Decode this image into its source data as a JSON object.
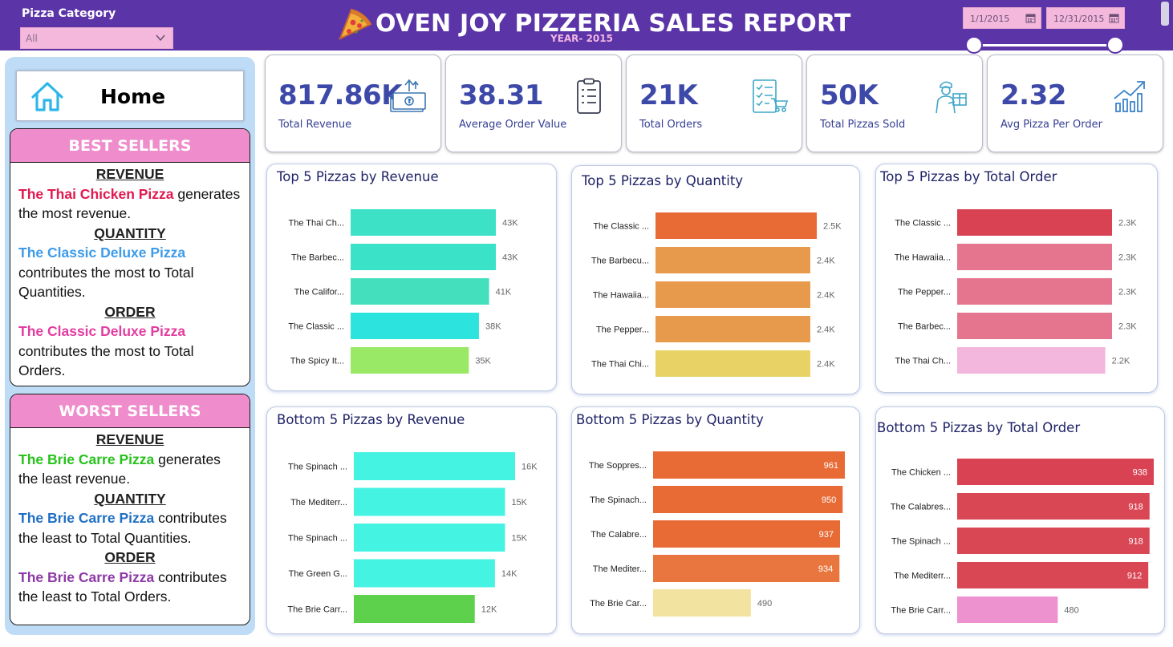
{
  "header": {
    "category_label": "Pizza Category",
    "category_value": "All",
    "title": "OVEN JOY PIZZERIA SALES REPORT",
    "subtitle": "YEAR- 2015",
    "date_start": "1/1/2015",
    "date_end": "12/31/2015"
  },
  "nav": {
    "home_label": "Home"
  },
  "best_sellers": {
    "title": "BEST SELLERS",
    "revenue_heading": "REVENUE",
    "revenue_pizza": "The Thai Chicken Pizza",
    "revenue_text": " generates the most revenue.",
    "quantity_heading": "QUANTITY",
    "quantity_pizza": "The Classic Deluxe Pizza",
    "quantity_text": " contributes the most to Total Quantities.",
    "order_heading": "ORDER",
    "order_pizza": "The Classic Deluxe Pizza",
    "order_text": " contributes the most to Total Orders."
  },
  "worst_sellers": {
    "title": "WORST SELLERS",
    "revenue_heading": "REVENUE",
    "revenue_pizza": "The Brie Carre Pizza",
    "revenue_text": " generates the least revenue.",
    "quantity_heading": "QUANTITY",
    "quantity_pizza": "The Brie Carre Pizza",
    "quantity_text": " contributes the least to Total Quantities.",
    "order_heading": "ORDER",
    "order_pizza": "The Brie Carre Pizza",
    "order_text": " contributes the least to Total Orders."
  },
  "colors": {
    "header_bg": "#5b35a8",
    "kpi_value": "#3c49a8",
    "best_rev": "#e0194f",
    "best_qty": "#3d9be9",
    "best_ord": "#e23d9f",
    "worst_rev": "#27c21c",
    "worst_qty": "#1f6fc4",
    "worst_ord": "#8e3aa6"
  },
  "kpis": [
    {
      "value": "817.86K",
      "label": "Total Revenue",
      "icon": "money-icon"
    },
    {
      "value": "38.31",
      "label": "Average Order Value",
      "icon": "clipboard-icon"
    },
    {
      "value": "21K",
      "label": "Total Orders",
      "icon": "order-list-icon"
    },
    {
      "value": "50K",
      "label": "Total Pizzas Sold",
      "icon": "delivery-icon"
    },
    {
      "value": "2.32",
      "label": "Avg Pizza Per Order",
      "icon": "growth-chart-icon"
    }
  ],
  "chart_data": [
    {
      "type": "bar",
      "orientation": "horizontal",
      "title": "Top 5 Pizzas by Revenue",
      "categories": [
        "The Thai Ch...",
        "The Barbec...",
        "The Califor...",
        "The Classic ...",
        "The Spicy It..."
      ],
      "values": [
        43000,
        43000,
        41000,
        38000,
        35000
      ],
      "labels": [
        "43K",
        "43K",
        "41K",
        "38K",
        "35K"
      ],
      "colors": [
        "#3ce1c6",
        "#3ae2c8",
        "#44e0be",
        "#2de3dd",
        "#99e966"
      ],
      "label_position": "outside"
    },
    {
      "type": "bar",
      "orientation": "horizontal",
      "title": "Top 5 Pizzas by Quantity",
      "categories": [
        "The Classic ...",
        "The Barbecu...",
        "The Hawaiia...",
        "The Pepper...",
        "The Thai Chi..."
      ],
      "values": [
        2500,
        2400,
        2400,
        2400,
        2400
      ],
      "labels": [
        "2.5K",
        "2.4K",
        "2.4K",
        "2.4K",
        "2.4K"
      ],
      "colors": [
        "#e86b36",
        "#e89a4c",
        "#e89a4c",
        "#e89a4c",
        "#e8d266"
      ],
      "label_position": "outside"
    },
    {
      "type": "bar",
      "orientation": "horizontal",
      "title": "Top 5 Pizzas by Total Order",
      "categories": [
        "The Classic ...",
        "The Hawaiia...",
        "The Pepper...",
        "The Barbec...",
        "The Thai Ch..."
      ],
      "values": [
        2300,
        2300,
        2300,
        2300,
        2200
      ],
      "labels": [
        "2.3K",
        "2.3K",
        "2.3K",
        "2.3K",
        "2.2K"
      ],
      "colors": [
        "#d94253",
        "#e5758e",
        "#e5758e",
        "#e5758e",
        "#f3b6dc"
      ],
      "label_position": "outside"
    },
    {
      "type": "bar",
      "orientation": "horizontal",
      "title": "Bottom 5 Pizzas by Revenue",
      "categories": [
        "The Spinach ...",
        "The Mediterr...",
        "The Spinach ...",
        "The Green G...",
        "The Brie Carr..."
      ],
      "values": [
        16000,
        15000,
        15000,
        14000,
        12000
      ],
      "labels": [
        "16K",
        "15K",
        "15K",
        "14K",
        "12K"
      ],
      "colors": [
        "#45f3e3",
        "#45f3e3",
        "#45f3e3",
        "#45f3e3",
        "#5ed14c"
      ],
      "label_position": "outside"
    },
    {
      "type": "bar",
      "orientation": "horizontal",
      "title": "Bottom 5 Pizzas by Quantity",
      "categories": [
        "The Soppres...",
        "The Spinach...",
        "The Calabre...",
        "The Mediter...",
        "The Brie Car..."
      ],
      "values": [
        961,
        950,
        937,
        934,
        490
      ],
      "labels": [
        "961",
        "950",
        "937",
        "934",
        "490"
      ],
      "colors": [
        "#e86b36",
        "#e86b36",
        "#e86b36",
        "#e8763e",
        "#f2e3a0"
      ],
      "label_position": "inside"
    },
    {
      "type": "bar",
      "orientation": "horizontal",
      "title": "Bottom 5 Pizzas by Total Order",
      "categories": [
        "The Chicken ...",
        "The Calabres...",
        "The Spinach ...",
        "The Mediterr...",
        "The Brie Carr..."
      ],
      "values": [
        938,
        918,
        918,
        912,
        480
      ],
      "labels": [
        "938",
        "918",
        "918",
        "912",
        "480"
      ],
      "colors": [
        "#d94253",
        "#d94654",
        "#d94654",
        "#d94654",
        "#ee91cf"
      ],
      "label_position": "inside"
    }
  ]
}
